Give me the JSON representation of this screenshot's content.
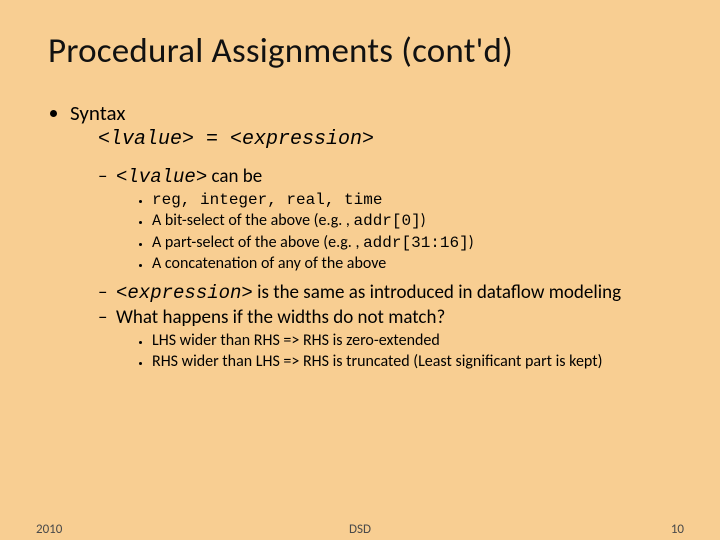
{
  "title": "Procedural Assignments (cont'd)",
  "syntax_label": "Syntax",
  "syntax_line_lvalue": "<lvalue>",
  "syntax_line_op": " = ",
  "syntax_line_expr": "<expression>",
  "lvalue_intro_code": "<lvalue>",
  "lvalue_intro_text": " can be",
  "lvalue_items": {
    "reg_line": "reg, integer, real, time",
    "bit_pre": "A bit-select of the above (e.g. , ",
    "bit_code": "addr[0]",
    "bit_post": ")",
    "part_pre": "A part-select of the above (e.g. , ",
    "part_code": "addr[31:16]",
    "part_post": ")",
    "concat": "A concatenation of any of the above"
  },
  "expr_code": "<expression>",
  "expr_text": " is the same as introduced in dataflow modeling",
  "width_q": "What happens if the widths do not match?",
  "width_items": {
    "lhs": "LHS wider than RHS => RHS is zero-extended",
    "rhs": "RHS wider than LHS => RHS is truncated (Least significant part is kept)"
  },
  "footer": {
    "year": "2010",
    "center": "DSD",
    "page": "10"
  }
}
